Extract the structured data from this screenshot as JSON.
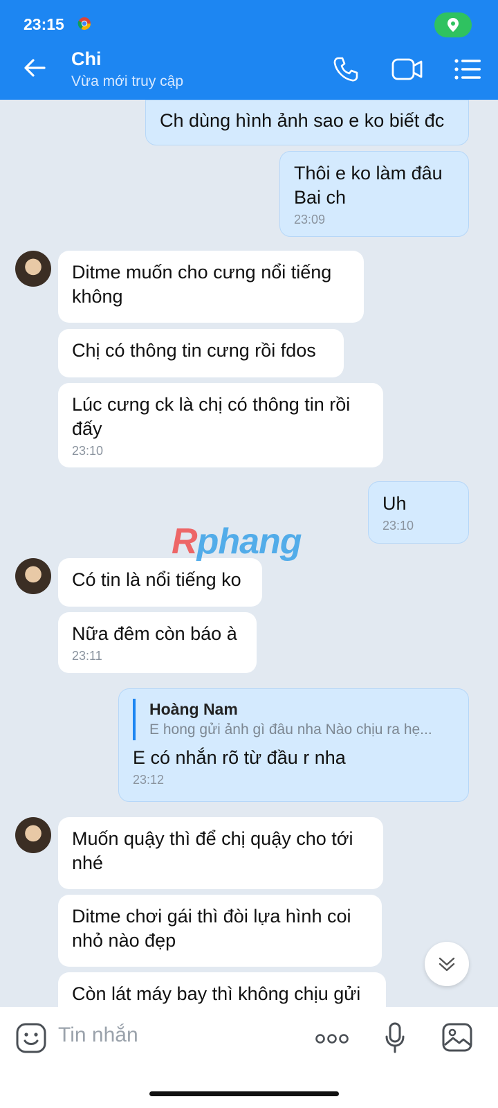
{
  "status_bar": {
    "time": "23:15"
  },
  "header": {
    "name": "Chi",
    "status": "Vừa mới truy cập"
  },
  "messages": [
    {
      "dir": "out",
      "lines": [
        "Ch dùng hình ảnh sao e ko biết đc"
      ],
      "time": ""
    },
    {
      "dir": "out",
      "lines": [
        "Thôi e ko làm đâu",
        "Bai ch"
      ],
      "time": "23:09"
    },
    {
      "dir": "in",
      "lines": [
        "Ditme muốn cho cưng nổi tiếng",
        "không"
      ],
      "time": ""
    },
    {
      "dir": "in",
      "lines": [
        "Chị có thông tin cưng rồi fdos"
      ],
      "time": ""
    },
    {
      "dir": "in",
      "lines": [
        "Lúc cưng ck là chị có thông tin rồi",
        "đấy"
      ],
      "time": "23:10"
    },
    {
      "dir": "out",
      "lines": [
        "Uh"
      ],
      "time": "23:10"
    },
    {
      "dir": "in",
      "lines": [
        "Có tin là nổi tiếng ko"
      ],
      "time": ""
    },
    {
      "dir": "in",
      "lines": [
        "Nữa đêm còn báo à"
      ],
      "time": "23:11"
    },
    {
      "dir": "out",
      "quote": {
        "name": "Hoàng Nam",
        "text": "E hong gửi ảnh gì đâu nha Nào chịu ra hẹ..."
      },
      "lines": [
        "E có nhắn rõ từ đầu r nha"
      ],
      "time": "23:12"
    },
    {
      "dir": "in",
      "lines": [
        "Muốn quậy thì để chị quậy cho tới",
        "nhé"
      ],
      "time": ""
    },
    {
      "dir": "in",
      "lines": [
        "Ditme chơi gái thì đòi lựa hình coi",
        "nhỏ nào đẹp"
      ],
      "time": ""
    },
    {
      "dir": "in",
      "lines": [
        "Còn lát máy bay thì không chịu gửi"
      ],
      "time": ""
    }
  ],
  "watermark": {
    "first": "R",
    "rest": "phang"
  },
  "input": {
    "placeholder": "Tin nhắn"
  },
  "icons": [
    "back-arrow-icon",
    "phone-icon",
    "video-call-icon",
    "menu-list-icon",
    "emoji-icon",
    "more-dots-icon",
    "microphone-icon",
    "gallery-icon",
    "scroll-down-icon"
  ],
  "colors": {
    "header": "#1d86f2",
    "outgoing_bubble": "#d4eafe",
    "incoming_bubble": "#ffffff",
    "chat_background": "#e2e9f1"
  }
}
